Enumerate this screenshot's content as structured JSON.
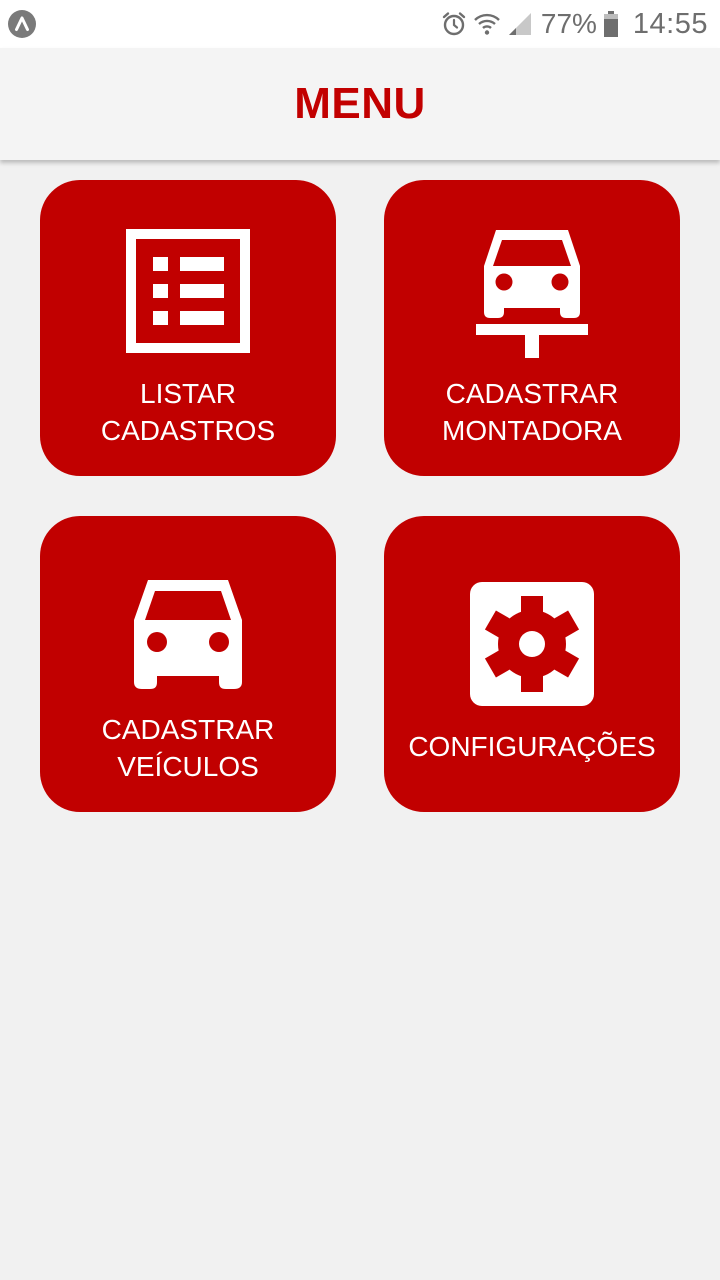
{
  "status_bar": {
    "battery_percent": "77%",
    "time": "14:55",
    "icons": [
      "app-notification-icon",
      "alarm-icon",
      "wifi-icon",
      "signal-icon",
      "battery-icon"
    ]
  },
  "app_bar": {
    "title": "MENU"
  },
  "menu": {
    "tiles": [
      {
        "label_line1": "LISTAR",
        "label_line2": "CADASTROS",
        "icon": "list-icon"
      },
      {
        "label_line1": "CADASTRAR",
        "label_line2": "MONTADORA",
        "icon": "car-lift-icon"
      },
      {
        "label_line1": "CADASTRAR",
        "label_line2": "VEÍCULOS",
        "icon": "car-icon"
      },
      {
        "label_line1": "CONFIGURAÇÕES",
        "label_line2": "",
        "icon": "settings-icon"
      }
    ]
  },
  "colors": {
    "accent": "#c10000",
    "background": "#f1f1f1",
    "app_bar": "#f4f4f4"
  }
}
